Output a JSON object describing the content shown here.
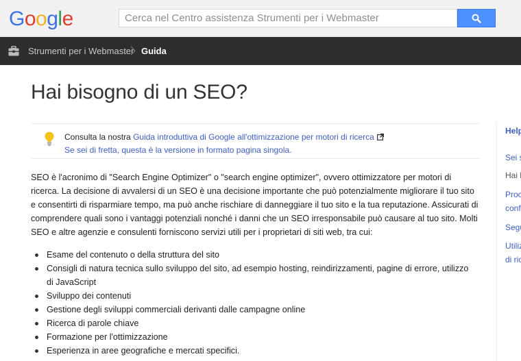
{
  "header": {
    "logo_letters": [
      {
        "ch": "G",
        "color": "#3b73e6"
      },
      {
        "ch": "o",
        "color": "#e03d2f"
      },
      {
        "ch": "o",
        "color": "#f3b321"
      },
      {
        "ch": "g",
        "color": "#3b73e6"
      },
      {
        "ch": "l",
        "color": "#2ea04c"
      },
      {
        "ch": "e",
        "color": "#e03d2f"
      }
    ],
    "search_placeholder": "Cerca nel Centro assistenza Strumenti per i Webmaster",
    "search_button_icon": "search-icon"
  },
  "nav": {
    "icon": "toolbox-icon",
    "breadcrumb_parent": "Strumenti per i Webmaster",
    "breadcrumb_current": "Guida"
  },
  "article": {
    "title": "Hai bisogno di un SEO?",
    "tip": {
      "icon": "lightbulb-icon",
      "line1_prefix": "Consulta la nostra ",
      "line1_link": "Guida introduttiva di Google all'ottimizzazione per motori di ricerca",
      "line2_link": "Se sei di fretta, questa è la versione in formato pagina singola."
    },
    "intro": "SEO è l'acronimo di \"Search Engine Optimizer\" o \"search engine optimizer\", ovvero ottimizzatore per motori di ricerca. La decisione di avvalersi di un SEO è una decisione importante che può potenzialmente migliorare il tuo sito e consentirti di risparmiare tempo, ma può anche rischiare di danneggiare il tuo sito e la tua reputazione. Assicurati di comprendere quali sono i vantaggi potenziali nonché i danni che un SEO irresponsabile può causare al tuo sito. Molti SEO e altre agenzie e consulenti forniscono servizi utili per i proprietari di siti web, tra cui:",
    "services": [
      "Esame del contenuto o della struttura del sito",
      "Consigli di natura tecnica sullo sviluppo del sito, ad esempio hosting, reindirizzamenti, pagine di errore, utilizzo di JavaScript",
      "Sviluppo dei contenuti",
      "Gestione degli sviluppi commerciali derivanti dalle campagne online",
      "Ricerca di parole chiave",
      "Formazione per l'ottimizzazione",
      "Esperienza in aree geografiche e mercati specifici."
    ]
  },
  "sidebar": {
    "title": "Help",
    "items": [
      "Sei s",
      "Hai b",
      "Proc",
      "confe",
      "Segu",
      "Utiliz",
      "di ric"
    ]
  },
  "colors": {
    "link": "#3d5fc2",
    "navbar": "#2d2d2d",
    "search_button": "#4d90fe"
  }
}
